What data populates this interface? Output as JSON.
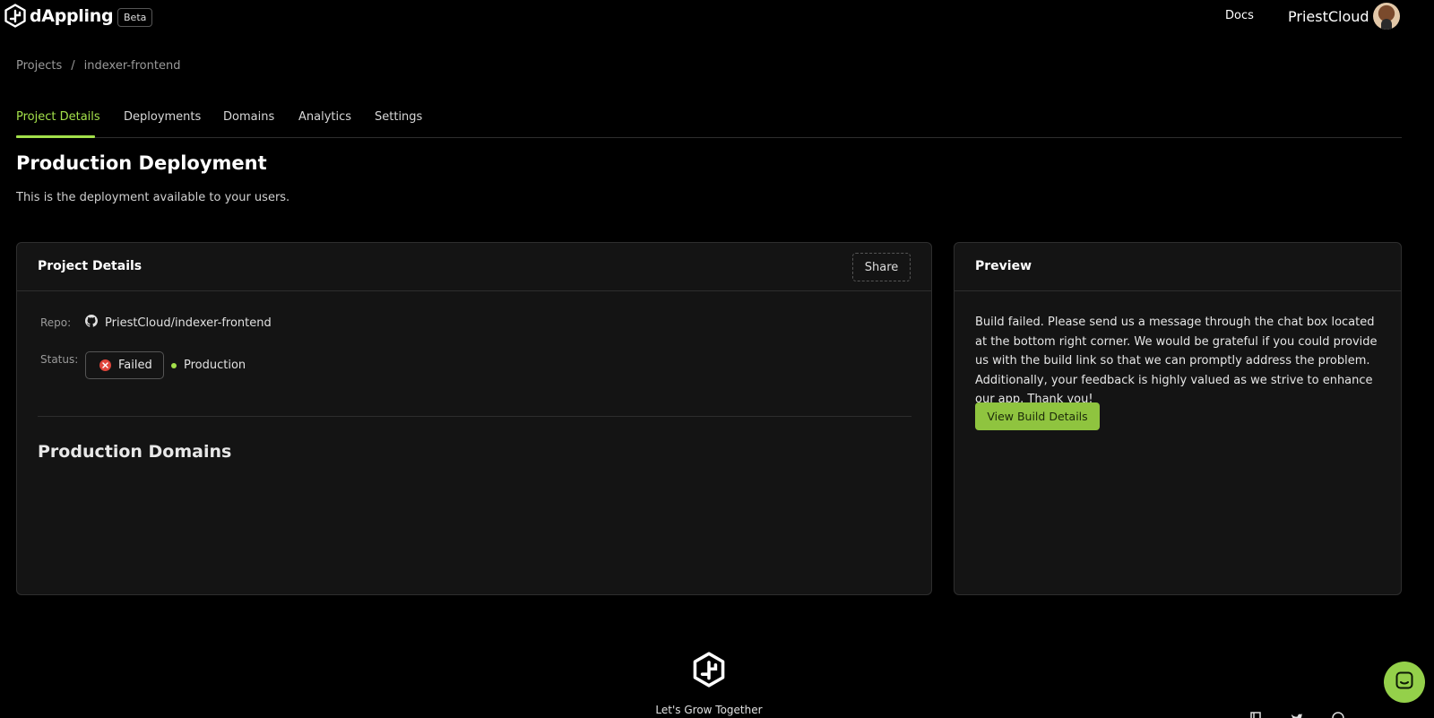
{
  "header": {
    "brand": "dAppling",
    "badge": "Beta",
    "docs_label": "Docs",
    "username": "PriestCloud"
  },
  "breadcrumb": {
    "items": [
      "Projects",
      "/",
      "indexer-frontend"
    ]
  },
  "tabs": [
    {
      "label": "Project Details",
      "active": true
    },
    {
      "label": "Deployments",
      "active": false
    },
    {
      "label": "Domains",
      "active": false
    },
    {
      "label": "Analytics",
      "active": false
    },
    {
      "label": "Settings",
      "active": false
    }
  ],
  "page": {
    "title": "Production Deployment",
    "subtitle": "This is the deployment available to your users."
  },
  "details_card": {
    "title": "Project Details",
    "share_label": "Share",
    "repo_label": "Repo:",
    "repo_value": "PriestCloud/indexer-frontend",
    "status_label": "Status:",
    "status_value": "Failed",
    "environment": "Production",
    "domains_title": "Production Domains"
  },
  "preview_card": {
    "title": "Preview",
    "message": "Build failed. Please send us a message through the chat box located at the bottom right corner. We would be grateful if you could provide us with the build link so that we can promptly address the problem. Additionally, your feedback is highly valued as we strive to enhance our app. Thank you!",
    "button_label": "View Build Details"
  },
  "footer": {
    "tagline": "Let's Grow Together"
  },
  "colors": {
    "accent": "#a3e04a",
    "button": "#8fc43f",
    "error": "#e0453a",
    "background": "#000000",
    "card": "#141414"
  }
}
